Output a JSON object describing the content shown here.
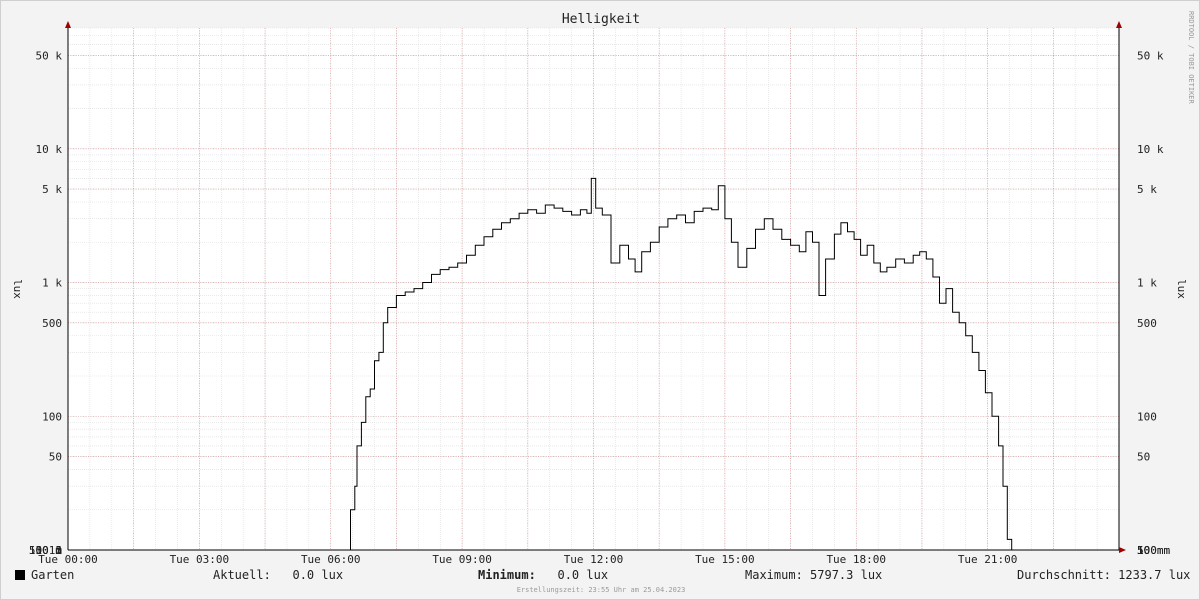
{
  "chart_data": {
    "type": "line",
    "title": "Helligkeit",
    "ylabel": "lux",
    "yscale": "log",
    "ylim": [
      10,
      80000
    ],
    "xlim_hours": [
      0,
      24
    ],
    "x_ticks": [
      "Tue 00:00",
      "Tue 03:00",
      "Tue 06:00",
      "Tue 09:00",
      "Tue 12:00",
      "Tue 15:00",
      "Tue 18:00",
      "Tue 21:00"
    ],
    "y_ticks": [
      {
        "label": "10 m",
        "value": 0.01
      },
      {
        "label": "50 m",
        "value": 0.05
      },
      {
        "label": "100 m",
        "value": 0.1
      },
      {
        "label": "500 m",
        "value": 0.5
      },
      {
        "label": "1",
        "value": 1
      },
      {
        "label": "5",
        "value": 5
      },
      {
        "label": "10",
        "value": 10
      },
      {
        "label": "50",
        "value": 50
      },
      {
        "label": "100",
        "value": 100
      },
      {
        "label": "500",
        "value": 500
      },
      {
        "label": "1 k",
        "value": 1000
      },
      {
        "label": "5 k",
        "value": 5000
      },
      {
        "label": "10 k",
        "value": 10000
      },
      {
        "label": "50 k",
        "value": 50000
      }
    ],
    "grid": true,
    "series": [
      {
        "name": "Garten",
        "color": "#000000",
        "points": [
          [
            0.0,
            0.01
          ],
          [
            3.4,
            0.01
          ],
          [
            3.45,
            0.05
          ],
          [
            3.55,
            0.05
          ],
          [
            3.6,
            0.01
          ],
          [
            4.0,
            0.01
          ],
          [
            4.05,
            0.05
          ],
          [
            4.3,
            0.05
          ],
          [
            4.35,
            0.01
          ],
          [
            4.45,
            0.01
          ],
          [
            4.5,
            0.05
          ],
          [
            4.6,
            0.05
          ],
          [
            4.65,
            0.01
          ],
          [
            5.4,
            0.01
          ],
          [
            5.45,
            0.05
          ],
          [
            5.7,
            0.05
          ],
          [
            5.75,
            0.18
          ],
          [
            5.85,
            0.45
          ],
          [
            5.95,
            0.45
          ],
          [
            6.0,
            0.8
          ],
          [
            6.05,
            0.5
          ],
          [
            6.15,
            0.8
          ],
          [
            6.25,
            5
          ],
          [
            6.35,
            10
          ],
          [
            6.45,
            20
          ],
          [
            6.55,
            30
          ],
          [
            6.6,
            60
          ],
          [
            6.7,
            90
          ],
          [
            6.8,
            140
          ],
          [
            6.9,
            160
          ],
          [
            7.0,
            260
          ],
          [
            7.1,
            300
          ],
          [
            7.2,
            500
          ],
          [
            7.3,
            650
          ],
          [
            7.5,
            800
          ],
          [
            7.7,
            850
          ],
          [
            7.9,
            900
          ],
          [
            8.1,
            1000
          ],
          [
            8.3,
            1150
          ],
          [
            8.5,
            1250
          ],
          [
            8.7,
            1300
          ],
          [
            8.9,
            1400
          ],
          [
            9.1,
            1600
          ],
          [
            9.3,
            1900
          ],
          [
            9.5,
            2200
          ],
          [
            9.7,
            2500
          ],
          [
            9.9,
            2800
          ],
          [
            10.1,
            3000
          ],
          [
            10.3,
            3300
          ],
          [
            10.5,
            3500
          ],
          [
            10.7,
            3300
          ],
          [
            10.9,
            3800
          ],
          [
            11.1,
            3600
          ],
          [
            11.3,
            3400
          ],
          [
            11.5,
            3200
          ],
          [
            11.7,
            3500
          ],
          [
            11.85,
            3300
          ],
          [
            11.95,
            6000
          ],
          [
            12.05,
            3600
          ],
          [
            12.2,
            3200
          ],
          [
            12.4,
            1400
          ],
          [
            12.6,
            1900
          ],
          [
            12.8,
            1500
          ],
          [
            12.95,
            1200
          ],
          [
            13.1,
            1700
          ],
          [
            13.3,
            2000
          ],
          [
            13.5,
            2600
          ],
          [
            13.7,
            3000
          ],
          [
            13.9,
            3200
          ],
          [
            14.1,
            2800
          ],
          [
            14.3,
            3400
          ],
          [
            14.5,
            3600
          ],
          [
            14.7,
            3500
          ],
          [
            14.85,
            5300
          ],
          [
            15.0,
            3000
          ],
          [
            15.15,
            2000
          ],
          [
            15.3,
            1300
          ],
          [
            15.5,
            1800
          ],
          [
            15.7,
            2500
          ],
          [
            15.9,
            3000
          ],
          [
            16.1,
            2500
          ],
          [
            16.3,
            2100
          ],
          [
            16.5,
            1900
          ],
          [
            16.7,
            1700
          ],
          [
            16.85,
            2400
          ],
          [
            17.0,
            2000
          ],
          [
            17.15,
            800
          ],
          [
            17.3,
            1500
          ],
          [
            17.5,
            2300
          ],
          [
            17.65,
            2800
          ],
          [
            17.8,
            2400
          ],
          [
            17.95,
            2100
          ],
          [
            18.1,
            1600
          ],
          [
            18.25,
            1900
          ],
          [
            18.4,
            1400
          ],
          [
            18.55,
            1200
          ],
          [
            18.7,
            1300
          ],
          [
            18.9,
            1500
          ],
          [
            19.1,
            1400
          ],
          [
            19.3,
            1600
          ],
          [
            19.45,
            1700
          ],
          [
            19.6,
            1500
          ],
          [
            19.75,
            1100
          ],
          [
            19.9,
            700
          ],
          [
            20.05,
            900
          ],
          [
            20.2,
            600
          ],
          [
            20.35,
            500
          ],
          [
            20.5,
            400
          ],
          [
            20.65,
            300
          ],
          [
            20.8,
            220
          ],
          [
            20.95,
            150
          ],
          [
            21.1,
            100
          ],
          [
            21.25,
            60
          ],
          [
            21.35,
            30
          ],
          [
            21.45,
            12
          ],
          [
            21.55,
            4
          ],
          [
            21.65,
            1
          ],
          [
            21.75,
            0.4
          ],
          [
            21.85,
            0.15
          ],
          [
            21.92,
            0.05
          ],
          [
            22.05,
            0.05
          ],
          [
            22.1,
            0.01
          ],
          [
            24.0,
            0.01
          ]
        ]
      }
    ],
    "legend": {
      "series_name": "Garten",
      "aktuell_label": "Aktuell:",
      "aktuell_value": "0.0 lux",
      "minimum_label": "Minimum:",
      "minimum_value": "0.0 lux",
      "maximum_label": "Maximum:",
      "maximum_value": "5797.3 lux",
      "avg_label": "Durchschnitt:",
      "avg_value": "1233.7 lux"
    },
    "footer": "Erstellungszeit: 23:55 Uhr am 25.04.2023",
    "watermark": "RRDTOOL / TOBI OETIKER"
  }
}
